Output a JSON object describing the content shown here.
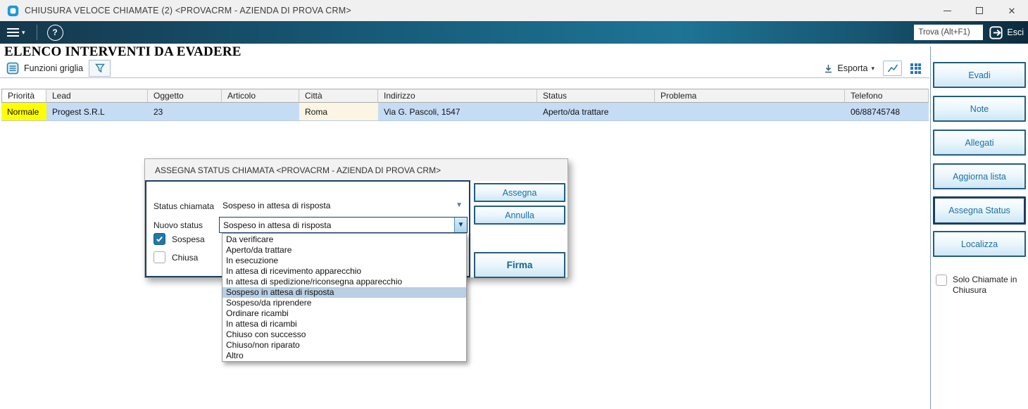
{
  "window": {
    "title": "CHIUSURA VELOCE CHIAMATE (2) <PROVACRM - AZIENDA DI PROVA CRM>"
  },
  "toolbar": {
    "find_value": "Trova (Alt+F1)",
    "exit_label": "Esci"
  },
  "page": {
    "title": "ELENCO INTERVENTI DA EVADERE"
  },
  "grid_toolbar": {
    "functions_label": "Funzioni griglia",
    "export_label": "Esporta"
  },
  "table": {
    "columns": [
      "Priorità",
      "Lead",
      "Oggetto",
      "Articolo",
      "Città",
      "Indirizzo",
      "Status",
      "Problema",
      "Telefono"
    ],
    "rows": [
      {
        "cells": [
          "Normale",
          "Progest S.R.L",
          "23",
          "",
          "Roma",
          "Via G. Pascoli, 1547",
          "Aperto/da trattare",
          "",
          "06/88745748"
        ]
      }
    ]
  },
  "dialog": {
    "title": "ASSEGNA STATUS CHIAMATA <PROVACRM - AZIENDA DI PROVA CRM>",
    "fields": {
      "status_chiamata_label": "Status chiamata",
      "status_chiamata_value": "Sospeso in attesa di risposta",
      "nuovo_status_label": "Nuovo status",
      "nuovo_status_value": "Sospeso in attesa di risposta",
      "sospesa_label": "Sospesa",
      "sospesa_checked": true,
      "chiusa_label": "Chiusa",
      "chiusa_checked": false
    },
    "buttons": {
      "assegna": "Assegna",
      "annulla": "Annulla",
      "firma": "Firma"
    },
    "dropdown_options": [
      "Da verificare",
      "Aperto/da trattare",
      "In esecuzione",
      "In attesa di ricevimento apparecchio",
      "In attesa di spedizione/riconsegna apparecchio",
      "Sospeso in attesa di risposta",
      "Sospeso/da riprendere",
      "Ordinare ricambi",
      "In attesa di ricambi",
      "Chiuso con successo",
      "Chiuso/non riparato",
      "Altro"
    ],
    "selected_option": "Sospeso in attesa di risposta"
  },
  "sidebar": {
    "buttons": [
      "Evadi",
      "Note",
      "Allegati",
      "Aggiorna lista",
      "Assegna Status",
      "Localizza"
    ],
    "focused_button": "Assegna Status",
    "checkbox_label": "Solo Chiamate in Chiusura",
    "checkbox_checked": false
  },
  "colors": {
    "accent_blue": "#1b6fa5",
    "toolbar_teal": "#1e7495",
    "selected_row": "#c5dcf5",
    "priority_yellow": "#ffff00",
    "city_cell": "#fcf5e3",
    "option_highlight": "#b8cfe4",
    "panel_border_navy": "#1b3e63"
  }
}
